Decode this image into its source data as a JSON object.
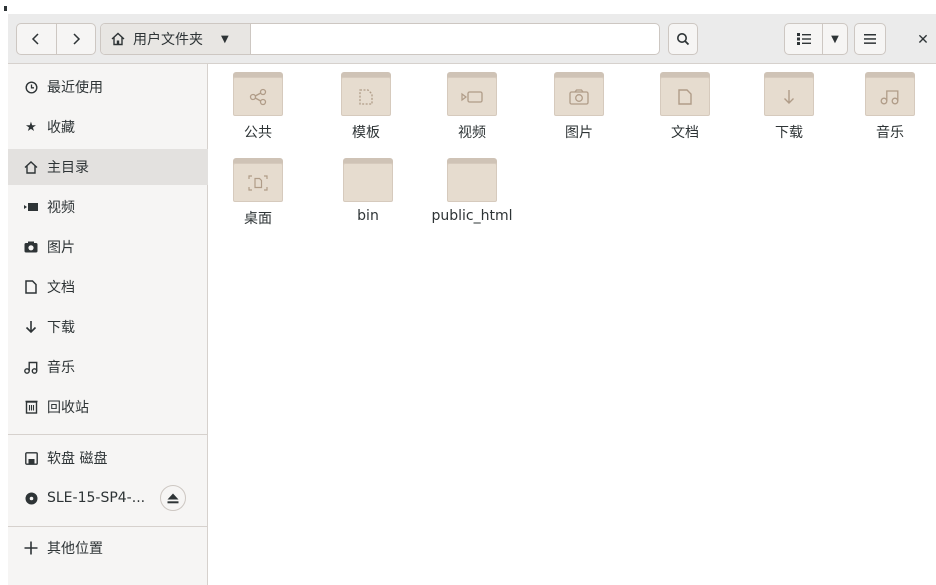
{
  "header": {
    "back_icon": "chevron-left-icon",
    "forward_icon": "chevron-right-icon",
    "location_label": "用户文件夹",
    "location_icon": "home-icon",
    "location_dropdown_icon": "caret-down-icon",
    "search_icon": "search-icon",
    "view_list_icon": "list-view-icon",
    "view_dropdown_icon": "caret-down-icon",
    "menu_icon": "hamburger-menu-icon",
    "close_icon": "close-icon"
  },
  "sidebar": {
    "items": [
      {
        "label": "最近使用",
        "icon": "clock-icon"
      },
      {
        "label": "收藏",
        "icon": "star-icon"
      },
      {
        "label": "主目录",
        "icon": "home-icon",
        "selected": true
      },
      {
        "label": "视频",
        "icon": "video-icon"
      },
      {
        "label": "图片",
        "icon": "camera-icon"
      },
      {
        "label": "文档",
        "icon": "document-icon"
      },
      {
        "label": "下载",
        "icon": "download-icon"
      },
      {
        "label": "音乐",
        "icon": "music-icon"
      },
      {
        "label": "回收站",
        "icon": "trash-icon"
      }
    ],
    "devices": [
      {
        "label": "软盘 磁盘",
        "icon": "floppy-icon"
      },
      {
        "label": "SLE-15-SP4-...",
        "icon": "disc-icon",
        "eject_icon": "eject-icon"
      }
    ],
    "other": {
      "label": "其他位置",
      "icon": "plus-icon"
    }
  },
  "files": [
    {
      "name": "公共",
      "emblem": "share-icon"
    },
    {
      "name": "模板",
      "emblem": "template-icon"
    },
    {
      "name": "视频",
      "emblem": "video-icon"
    },
    {
      "name": "图片",
      "emblem": "camera-icon"
    },
    {
      "name": "文档",
      "emblem": "document-icon"
    },
    {
      "name": "下载",
      "emblem": "download-icon"
    },
    {
      "name": "音乐",
      "emblem": "music-icon"
    },
    {
      "name": "桌面",
      "emblem": "desktop-icon"
    },
    {
      "name": "bin",
      "emblem": ""
    },
    {
      "name": "public_html",
      "emblem": ""
    }
  ],
  "colors": {
    "folder_body": "#e6dccf",
    "folder_tab": "#cfc3b6",
    "sidebar_bg": "#f6f5f4",
    "selected_bg": "#e3e1df"
  }
}
